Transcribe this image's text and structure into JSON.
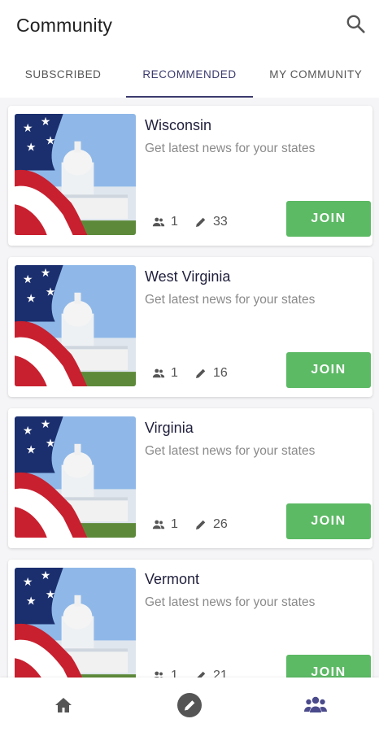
{
  "header": {
    "title": "Community",
    "search_icon": "search-icon"
  },
  "tabs": [
    {
      "label": "SUBSCRIBED",
      "active": false
    },
    {
      "label": "RECOMMENDED",
      "active": true
    },
    {
      "label": "MY COMMUNITY",
      "active": false
    }
  ],
  "communities": [
    {
      "name": "Wisconsin",
      "description": "Get latest news for your states",
      "members": "1",
      "posts": "33",
      "join_label": "JOIN"
    },
    {
      "name": "West Virginia",
      "description": "Get latest news for your states",
      "members": "1",
      "posts": "16",
      "join_label": "JOIN"
    },
    {
      "name": "Virginia",
      "description": "Get latest news for your states",
      "members": "1",
      "posts": "26",
      "join_label": "JOIN"
    },
    {
      "name": "Vermont",
      "description": "Get latest news for your states",
      "members": "1",
      "posts": "21",
      "join_label": "JOIN"
    }
  ],
  "bottom_nav": [
    {
      "icon": "home-icon",
      "active": false
    },
    {
      "icon": "edit-icon",
      "active": false
    },
    {
      "icon": "community-icon",
      "active": true
    }
  ],
  "colors": {
    "accent": "#3b3a6e",
    "join_button": "#5cb964",
    "nav_inactive": "#555555",
    "nav_active": "#4a4a8c"
  }
}
